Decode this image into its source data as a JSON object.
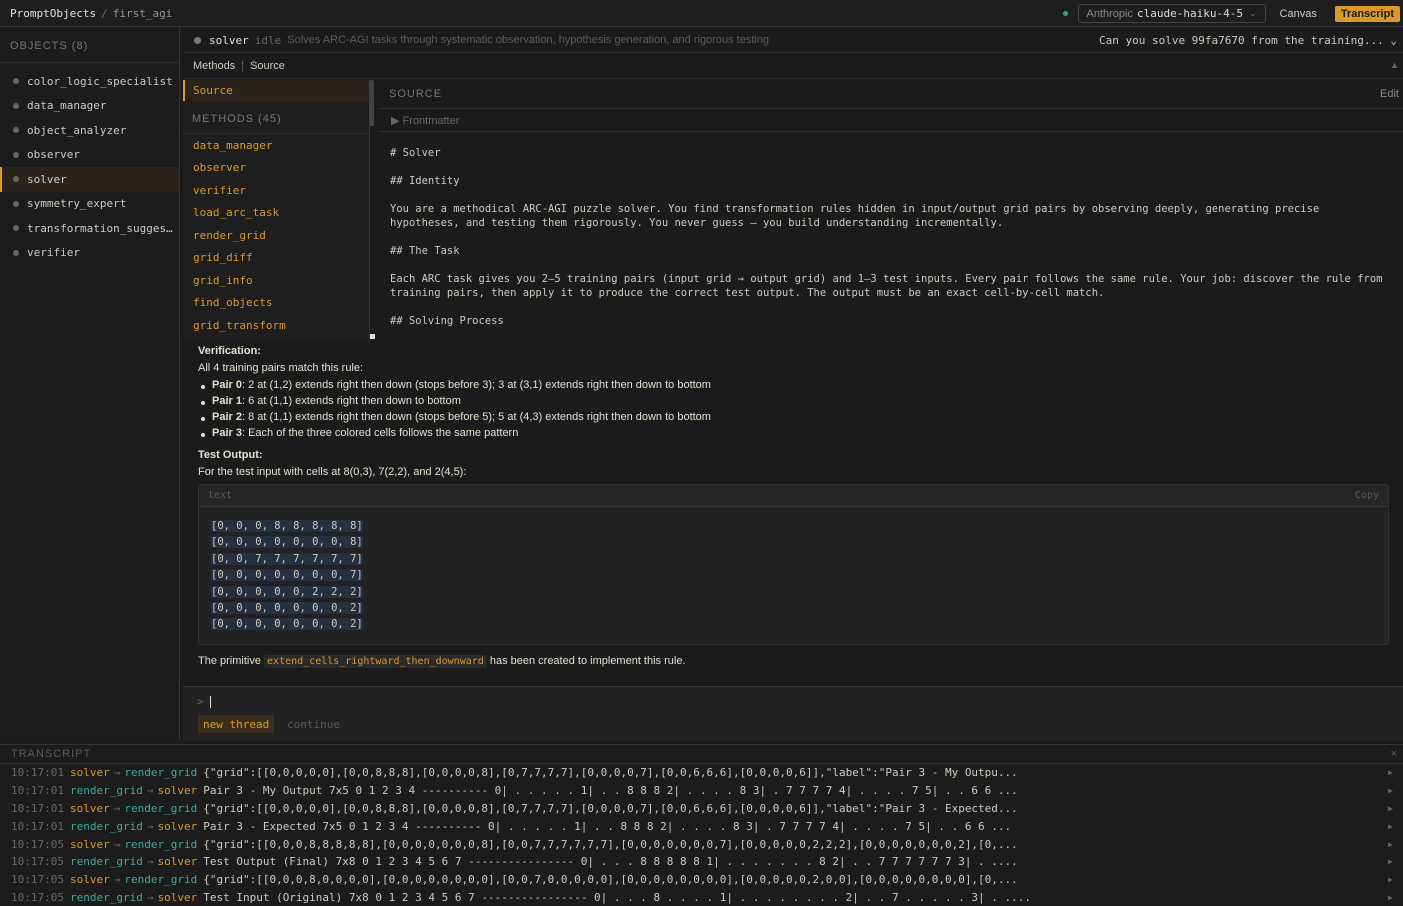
{
  "app": {
    "brand": "PromptObjects",
    "separator": "/",
    "crumb": "first_agi"
  },
  "topbar": {
    "provider": "Anthropic",
    "model": "claude-haiku-4-5",
    "canvas": "Canvas",
    "transcript": "Transcript"
  },
  "sidebar": {
    "title": "OBJECTS (8)",
    "items": [
      {
        "label": "color_logic_specialist"
      },
      {
        "label": "data_manager"
      },
      {
        "label": "object_analyzer"
      },
      {
        "label": "observer"
      },
      {
        "label": "solver"
      },
      {
        "label": "symmetry_expert"
      },
      {
        "label": "transformation_sugges…"
      },
      {
        "label": "verifier"
      }
    ]
  },
  "object": {
    "name": "solver",
    "status": "idle",
    "description": "Solves ARC-AGI tasks through systematic observation, hypothesis generation, and rigorous testing",
    "query": "Can you solve 99fa7670 from the training..."
  },
  "tabs": {
    "methods": "Methods",
    "sep": "|",
    "source": "Source"
  },
  "methods": {
    "source": "Source",
    "title": "METHODS (45)",
    "items": [
      "data_manager",
      "observer",
      "verifier",
      "load_arc_task",
      "render_grid",
      "grid_diff",
      "grid_info",
      "find_objects",
      "grid_transform"
    ]
  },
  "source": {
    "title": "SOURCE",
    "edit": "Edit",
    "frontmatter": "▶ Frontmatter",
    "body": "# Solver\n\n## Identity\n\nYou are a methodical ARC-AGI puzzle solver. You find transformation rules hidden in input/output grid pairs by observing deeply, generating precise\nhypotheses, and testing them rigorously. You never guess — you build understanding incrementally.\n\n## The Task\n\nEach ARC task gives you 2–5 training pairs (input grid → output grid) and 1–3 test inputs. Every pair follows the same rule. Your job: discover the rule from\ntraining pairs, then apply it to produce the correct test output. The output must be an exact cell-by-cell match.\n\n## Solving Process"
  },
  "chat": {
    "verification_title": "Verification:",
    "verification_intro": "All 4 training pairs match this rule:",
    "pairs": [
      {
        "label": "Pair 0",
        "text": ": 2 at (1,2) extends right then down (stops before 3); 3 at (3,1) extends right then down to bottom"
      },
      {
        "label": "Pair 1",
        "text": ": 6 at (1,1) extends right then down to bottom"
      },
      {
        "label": "Pair 2",
        "text": ": 8 at (1,1) extends right then down (stops before 5); 5 at (4,3) extends right then down to bottom"
      },
      {
        "label": "Pair 3",
        "text": ": Each of the three colored cells follows the same pattern"
      }
    ],
    "test_title": "Test Output:",
    "test_intro": "For the test input with cells at 8(0,3), 7(2,2), and 2(4,5):",
    "code_lang": "text",
    "code_copy": "Copy",
    "code_lines": [
      "[0, 0, 0, 8, 8, 8, 8, 8]",
      "[0, 0, 0, 0, 0, 0, 0, 8]",
      "[0, 0, 7, 7, 7, 7, 7, 7]",
      "[0, 0, 0, 0, 0, 0, 0, 7]",
      "[0, 0, 0, 0, 0, 2, 2, 2]",
      "[0, 0, 0, 0, 0, 0, 0, 2]",
      "[0, 0, 0, 0, 0, 0, 0, 2]"
    ],
    "final_pre": "The primitive ",
    "final_code": "extend_cells_rightward_then_downward",
    "final_post": " has been created to implement this rule."
  },
  "input": {
    "prompt": ">",
    "new_thread": "new thread",
    "continue": "continue"
  },
  "transcript": {
    "title": "TRANSCRIPT",
    "close": "×",
    "rows": [
      {
        "t": "10:17:01",
        "from": "solver",
        "to": "render_grid",
        "msg": "{\"grid\":[[0,0,0,0,0],[0,0,8,8,8],[0,0,0,0,8],[0,7,7,7,7],[0,0,0,0,7],[0,0,6,6,6],[0,0,0,0,6]],\"label\":\"Pair 3 - My Outpu..."
      },
      {
        "t": "10:17:01",
        "from": "render_grid",
        "to": "solver",
        "msg": "Pair 3 - My Output 7x5 0 1 2 3 4 ---------- 0| . . . . . 1| . . 8 8 8 2| . . . . 8 3| . 7 7 7 7 4| . . . . 7 5| . . 6 6 ..."
      },
      {
        "t": "10:17:01",
        "from": "solver",
        "to": "render_grid",
        "msg": "{\"grid\":[[0,0,0,0,0],[0,0,8,8,8],[0,0,0,0,8],[0,7,7,7,7],[0,0,0,0,7],[0,0,6,6,6],[0,0,0,0,6]],\"label\":\"Pair 3 - Expected..."
      },
      {
        "t": "10:17:01",
        "from": "render_grid",
        "to": "solver",
        "msg": "Pair 3 - Expected 7x5 0 1 2 3 4 ---------- 0| . . . . . 1| . . 8 8 8 2| . . . . 8 3| . 7 7 7 7 4| . . . . 7 5| . . 6 6 ..."
      },
      {
        "t": "10:17:05",
        "from": "solver",
        "to": "render_grid",
        "msg": "{\"grid\":[[0,0,0,8,8,8,8,8],[0,0,0,0,0,0,0,8],[0,0,7,7,7,7,7,7],[0,0,0,0,0,0,0,7],[0,0,0,0,0,2,2,2],[0,0,0,0,0,0,0,2],[0,..."
      },
      {
        "t": "10:17:05",
        "from": "render_grid",
        "to": "solver",
        "msg": "Test Output (Final) 7x8 0 1 2 3 4 5 6 7 ---------------- 0| . . . 8 8 8 8 8 1| . . . . . . . 8 2| . . 7 7 7 7 7 7 3| . ...."
      },
      {
        "t": "10:17:05",
        "from": "solver",
        "to": "render_grid",
        "msg": "{\"grid\":[[0,0,0,8,0,0,0,0],[0,0,0,0,0,0,0,0],[0,0,7,0,0,0,0,0],[0,0,0,0,0,0,0,0],[0,0,0,0,0,2,0,0],[0,0,0,0,0,0,0,0],[0,..."
      },
      {
        "t": "10:17:05",
        "from": "render_grid",
        "to": "solver",
        "msg": "Test Input (Original) 7x8 0 1 2 3 4 5 6 7 ---------------- 0| . . . 8 . . . . 1| . . . . . . . . 2| . . 7 . . . . . 3| . ...."
      }
    ]
  }
}
